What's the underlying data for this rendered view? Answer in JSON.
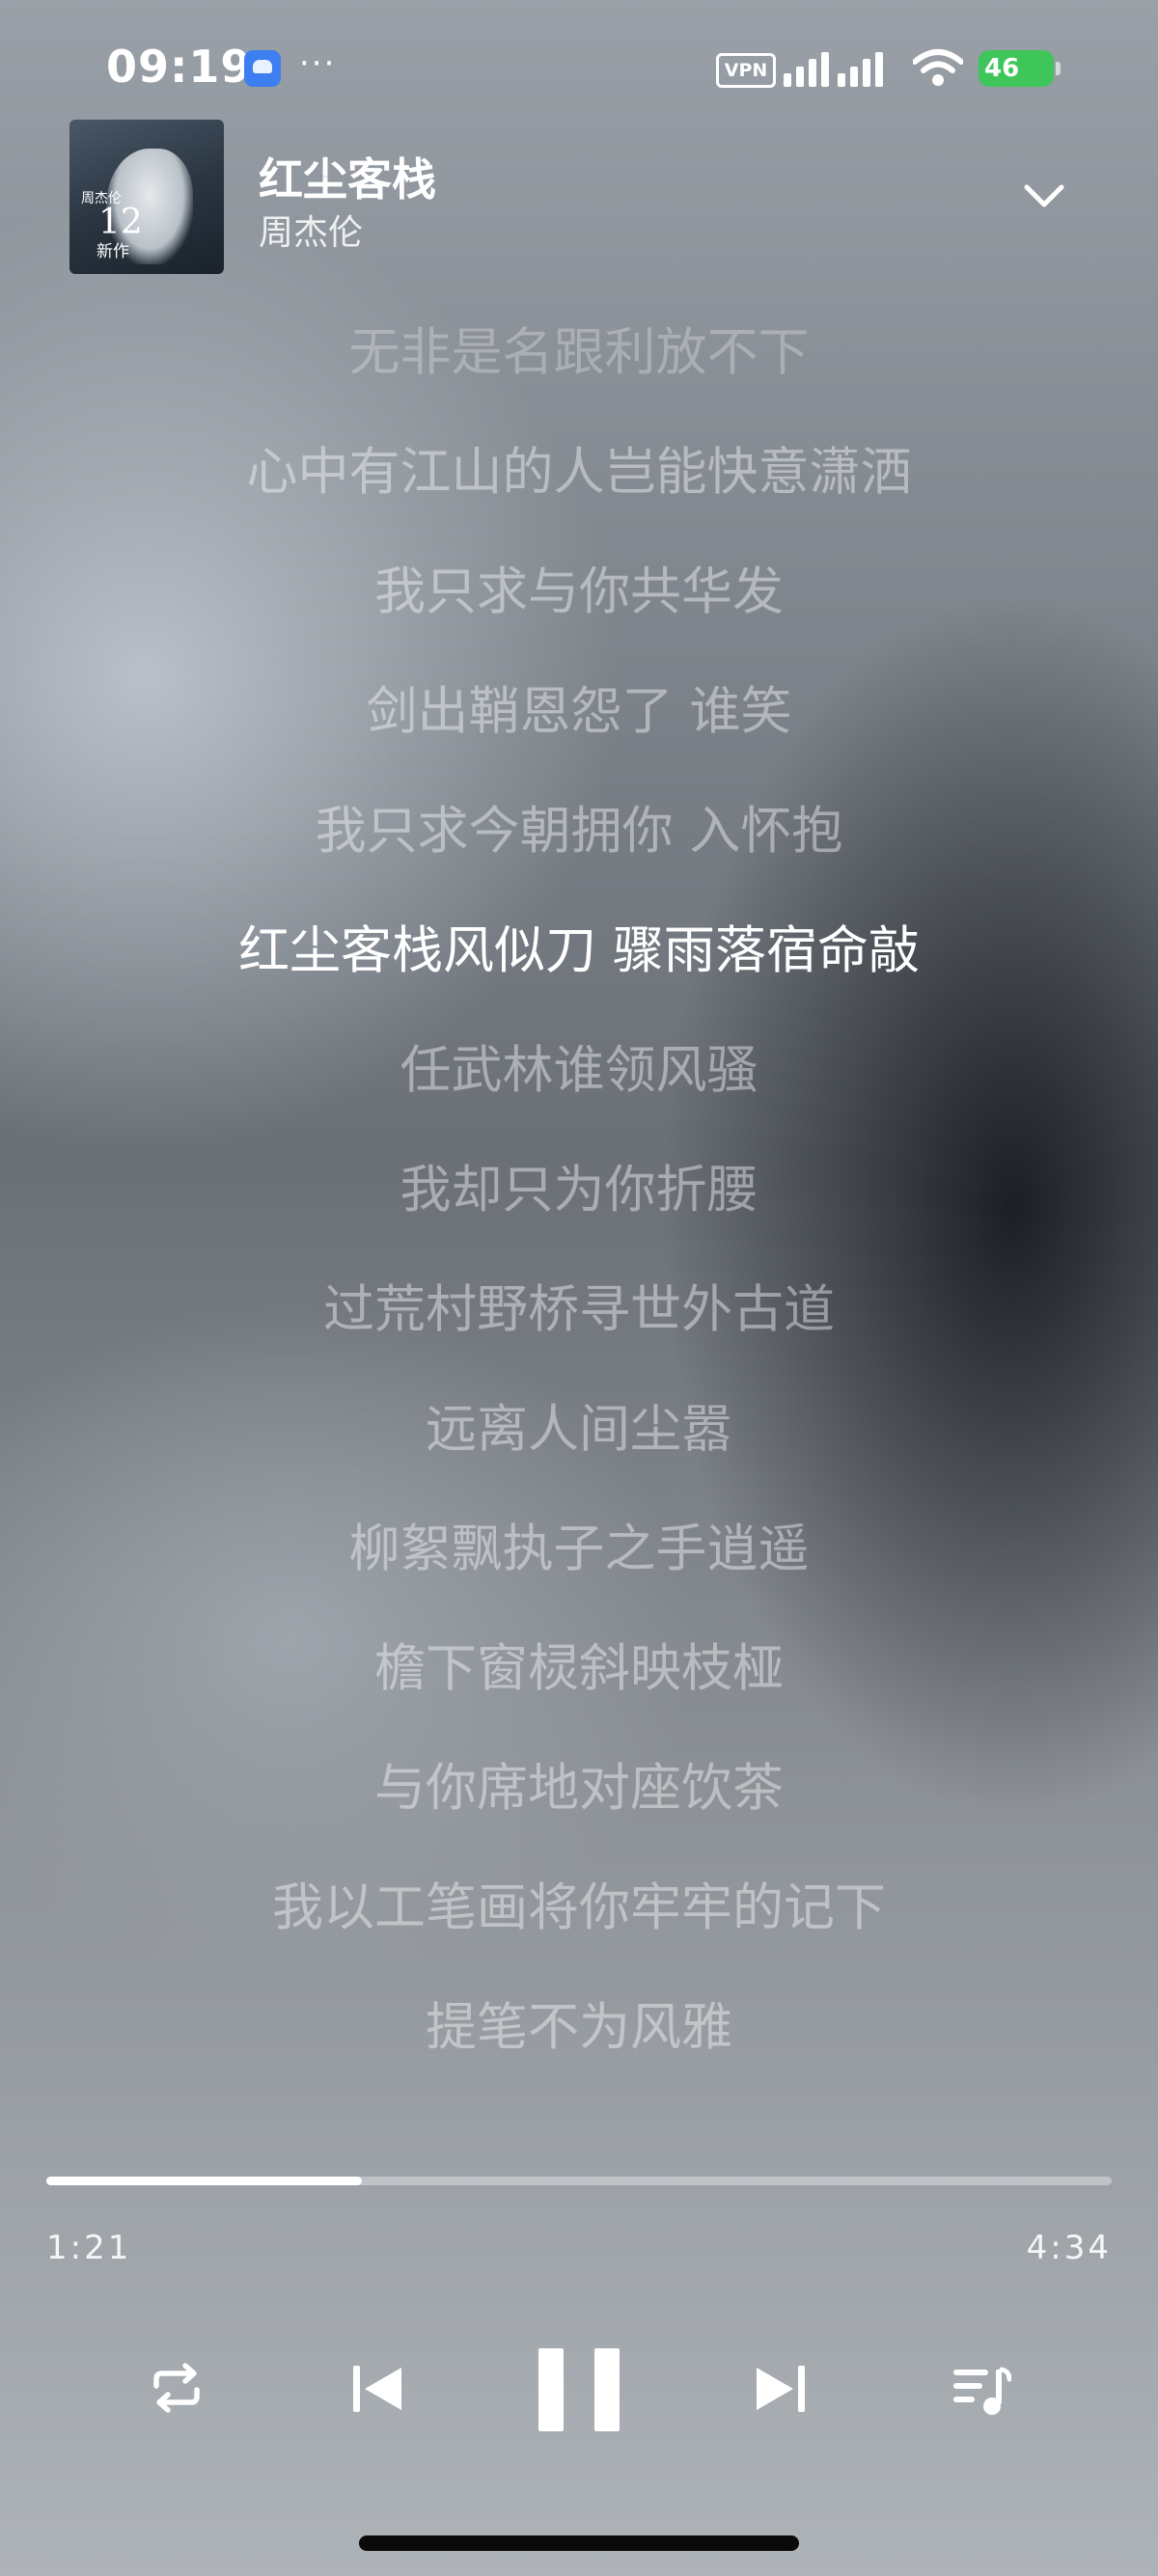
{
  "status_bar": {
    "time": "09:19",
    "more": "···",
    "vpn": "VPN",
    "battery": "46",
    "battery_color": "#3fc65a"
  },
  "header": {
    "song_title": "红尘客栈",
    "artist": "周杰伦",
    "album_art_text": "周杰伦 12 新作"
  },
  "lyrics": {
    "lines": [
      "无非是名跟利放不下",
      "心中有江山的人岂能快意潇洒",
      "我只求与你共华发",
      "剑出鞘恩怨了 谁笑",
      "我只求今朝拥你 入怀抱",
      "红尘客栈风似刀 骤雨落宿命敲",
      "任武林谁领风骚",
      "我却只为你折腰",
      "过荒村野桥寻世外古道",
      "远离人间尘嚣",
      "柳絮飘执子之手逍遥",
      "檐下窗棂斜映枝桠",
      "与你席地对座饮茶",
      "我以工笔画将你牢牢的记下",
      "提笔不为风雅"
    ],
    "active_index": 5
  },
  "player": {
    "elapsed": "1:21",
    "total": "4:34",
    "progress": 0.296
  },
  "controls": {
    "icons": [
      "repeat-icon",
      "previous-icon",
      "pause-icon",
      "next-icon",
      "playlist-icon"
    ]
  }
}
